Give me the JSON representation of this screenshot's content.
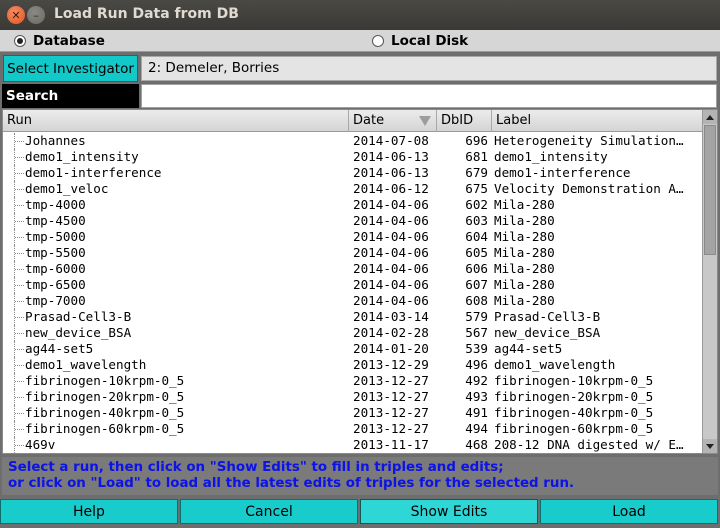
{
  "window": {
    "title": "Load Run Data from DB"
  },
  "source": {
    "database_label": "Database",
    "database_selected": true,
    "local_disk_label": "Local Disk",
    "local_disk_selected": false
  },
  "investigator": {
    "button_label": "Select Investigator",
    "value": "2: Demeler, Borries"
  },
  "search": {
    "label": "Search",
    "value": ""
  },
  "table": {
    "columns": {
      "run": "Run",
      "date": "Date",
      "dbid": "DbID",
      "label": "Label"
    },
    "sorted_column": "Date",
    "rows": [
      {
        "run": "Johannes",
        "date": "2014-07-08",
        "dbid": "696",
        "label": "Heterogeneity Simulation…"
      },
      {
        "run": "demo1_intensity",
        "date": "2014-06-13",
        "dbid": "681",
        "label": "demo1_intensity"
      },
      {
        "run": "demo1-interference",
        "date": "2014-06-13",
        "dbid": "679",
        "label": "demo1-interference"
      },
      {
        "run": "demo1_veloc",
        "date": "2014-06-12",
        "dbid": "675",
        "label": "Velocity Demonstration A…"
      },
      {
        "run": "tmp-4000",
        "date": "2014-04-06",
        "dbid": "602",
        "label": "Mila-280"
      },
      {
        "run": "tmp-4500",
        "date": "2014-04-06",
        "dbid": "603",
        "label": "Mila-280"
      },
      {
        "run": "tmp-5000",
        "date": "2014-04-06",
        "dbid": "604",
        "label": "Mila-280"
      },
      {
        "run": "tmp-5500",
        "date": "2014-04-06",
        "dbid": "605",
        "label": "Mila-280"
      },
      {
        "run": "tmp-6000",
        "date": "2014-04-06",
        "dbid": "606",
        "label": "Mila-280"
      },
      {
        "run": "tmp-6500",
        "date": "2014-04-06",
        "dbid": "607",
        "label": "Mila-280"
      },
      {
        "run": "tmp-7000",
        "date": "2014-04-06",
        "dbid": "608",
        "label": "Mila-280"
      },
      {
        "run": "Prasad-Cell3-B",
        "date": "2014-03-14",
        "dbid": "579",
        "label": "Prasad-Cell3-B"
      },
      {
        "run": "new_device_BSA",
        "date": "2014-02-28",
        "dbid": "567",
        "label": "new_device_BSA"
      },
      {
        "run": "ag44-set5",
        "date": "2014-01-20",
        "dbid": "539",
        "label": "ag44-set5"
      },
      {
        "run": "demo1_wavelength",
        "date": "2013-12-29",
        "dbid": "496",
        "label": "demo1_wavelength"
      },
      {
        "run": "fibrinogen-10krpm-0_5",
        "date": "2013-12-27",
        "dbid": "492",
        "label": "fibrinogen-10krpm-0_5"
      },
      {
        "run": "fibrinogen-20krpm-0_5",
        "date": "2013-12-27",
        "dbid": "493",
        "label": "fibrinogen-20krpm-0_5"
      },
      {
        "run": "fibrinogen-40krpm-0_5",
        "date": "2013-12-27",
        "dbid": "491",
        "label": "fibrinogen-40krpm-0_5"
      },
      {
        "run": "fibrinogen-60krpm-0_5",
        "date": "2013-12-27",
        "dbid": "494",
        "label": "fibrinogen-60krpm-0_5"
      },
      {
        "run": "469v",
        "date": "2013-11-17",
        "dbid": "468",
        "label": "208-12 DNA digested w/ E…"
      }
    ]
  },
  "status": {
    "line1": "Select a run, then click on \"Show Edits\" to fill in triples and edits;",
    "line2": "or click on \"Load\" to load all the latest edits of triples for the selected run.",
    "color": "#0c12e8"
  },
  "buttons": {
    "help": "Help",
    "cancel": "Cancel",
    "show_edits": "Show Edits",
    "load": "Load"
  },
  "colors": {
    "button": "#18cccc",
    "title_bar": "#3c3b37"
  }
}
